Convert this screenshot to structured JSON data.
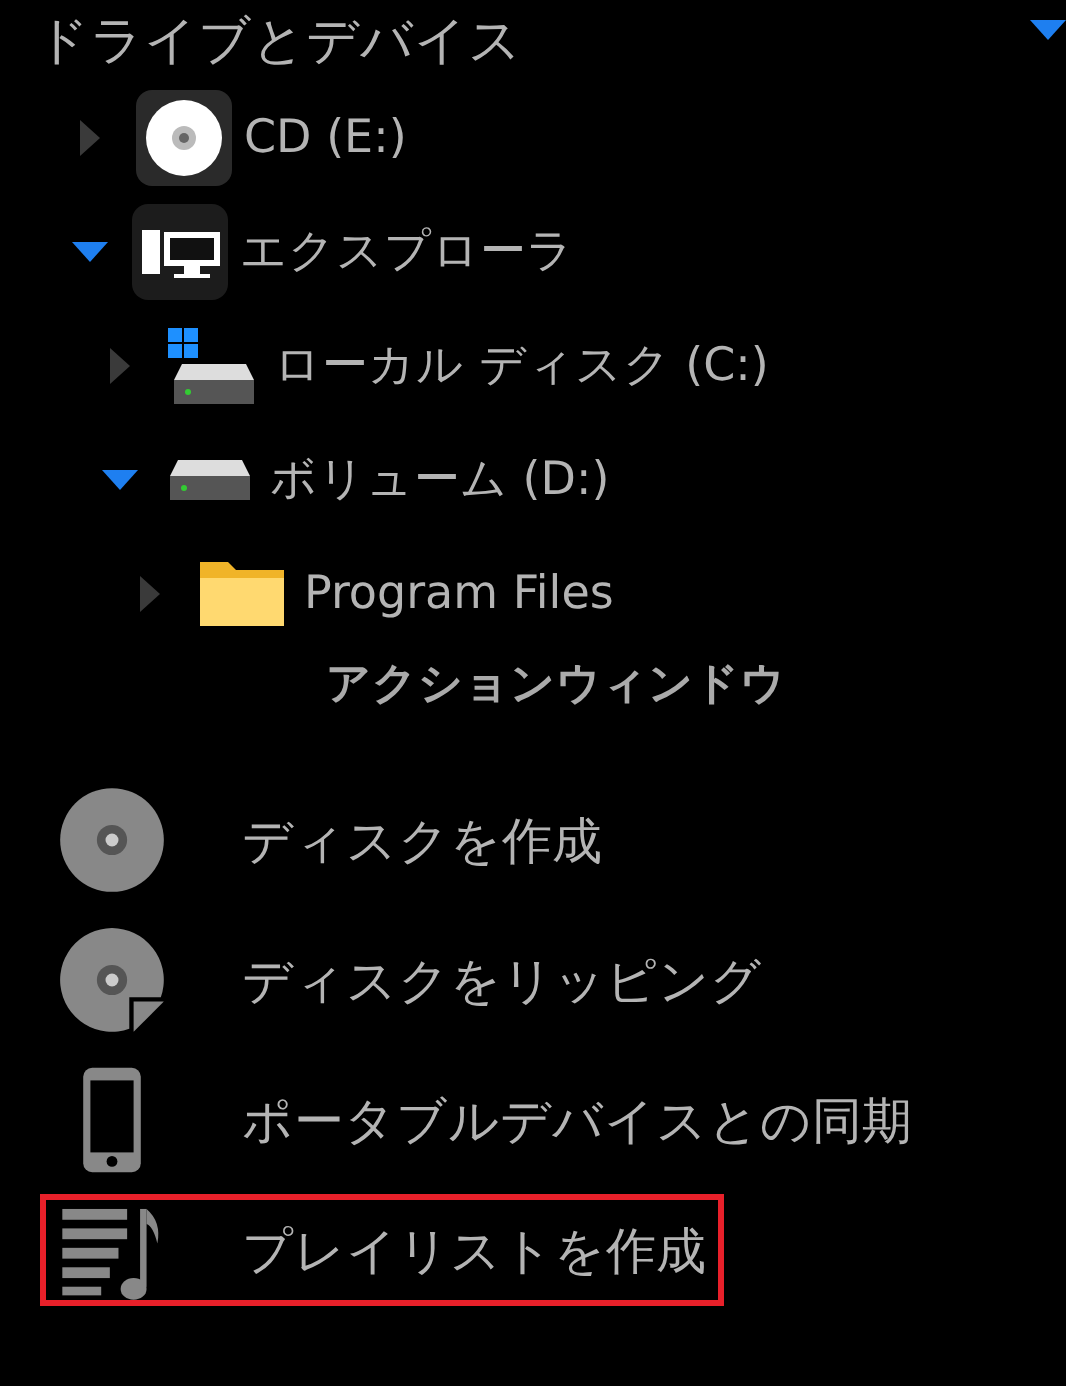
{
  "section": {
    "title": "ドライブとデバイス",
    "expanded": true
  },
  "tree": [
    {
      "label": "CD (E:)",
      "kind": "cd",
      "expanded": false
    },
    {
      "label": "エクスプローラ",
      "kind": "computer",
      "expanded": true,
      "children": [
        {
          "label": "ローカル ディスク (C:)",
          "kind": "system-drive",
          "expanded": false
        },
        {
          "label": "ボリューム (D:)",
          "kind": "drive",
          "expanded": true,
          "children": [
            {
              "label": "Program Files",
              "kind": "folder",
              "expanded": false
            }
          ]
        }
      ]
    }
  ],
  "actions": {
    "title": "アクションウィンドウ",
    "items": [
      {
        "label": "ディスクを作成",
        "kind": "burn",
        "highlighted": false
      },
      {
        "label": "ディスクをリッピング",
        "kind": "rip",
        "highlighted": false
      },
      {
        "label": "ポータブルデバイスとの同期",
        "kind": "sync",
        "highlighted": false
      },
      {
        "label": "プレイリストを作成",
        "kind": "playlist",
        "highlighted": true
      }
    ]
  }
}
